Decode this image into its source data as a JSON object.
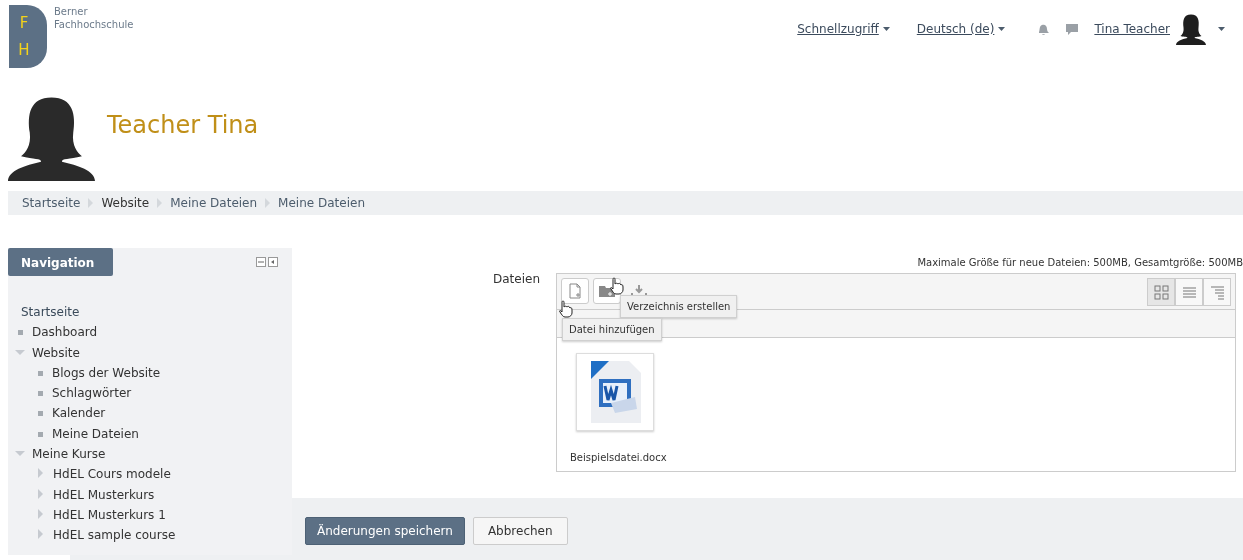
{
  "header": {
    "logo_letters": [
      "F",
      "H"
    ],
    "logo_text": [
      "Berner",
      "Fachhochschule"
    ],
    "menus": [
      {
        "label": "Schnellzugriff"
      },
      {
        "label": "Deutsch (de)"
      }
    ],
    "user_name": "Tina Teacher"
  },
  "profile": {
    "name": "Teacher Tina"
  },
  "breadcrumb": [
    "Startseite",
    "Website",
    "Meine Dateien",
    "Meine Dateien"
  ],
  "navigation": {
    "title": "Navigation",
    "root": "Startseite",
    "items": [
      {
        "label": "Dashboard",
        "kind": "leaf"
      },
      {
        "label": "Website",
        "kind": "branch",
        "expanded": true,
        "children": [
          {
            "label": "Blogs der Website",
            "kind": "leaf"
          },
          {
            "label": "Schlagwörter",
            "kind": "leaf"
          },
          {
            "label": "Kalender",
            "kind": "leaf"
          },
          {
            "label": "Meine Dateien",
            "kind": "leaf"
          }
        ]
      },
      {
        "label": "Meine Kurse",
        "kind": "branch",
        "expanded": true,
        "children": [
          {
            "label": "HdEL Cours modele",
            "kind": "branch",
            "expanded": false
          },
          {
            "label": "HdEL Musterkurs",
            "kind": "branch",
            "expanded": false
          },
          {
            "label": "HdEL Musterkurs 1",
            "kind": "branch",
            "expanded": false
          },
          {
            "label": "HdEL sample course",
            "kind": "branch",
            "expanded": false
          }
        ]
      }
    ]
  },
  "files": {
    "label": "Dateien",
    "limits": "Maximale Größe für neue Dateien: 500MB, Gesamtgröße: 500MB",
    "tooltips": [
      "Verzeichnis erstellen",
      "Datei hinzufügen"
    ],
    "views": [
      {
        "kind": "icons",
        "selected": true
      },
      {
        "kind": "list",
        "selected": false
      },
      {
        "kind": "tree",
        "selected": false
      }
    ],
    "items": [
      {
        "name": "Beispielsdatei.docx"
      }
    ]
  },
  "buttons": [
    {
      "label": "Änderungen speichern",
      "kind": "primary"
    },
    {
      "label": "Abbrechen",
      "kind": "secondary"
    }
  ]
}
